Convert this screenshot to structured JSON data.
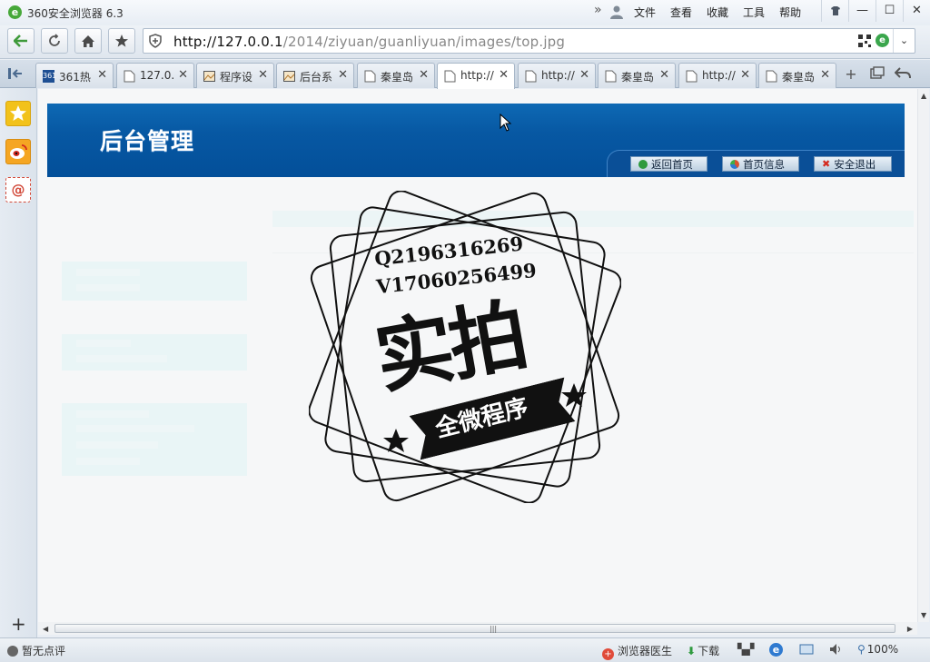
{
  "window": {
    "title": "360安全浏览器 6.3",
    "menu": [
      "文件",
      "查看",
      "收藏",
      "工具",
      "帮助"
    ],
    "controls": [
      "skin",
      "minimize",
      "maximize",
      "close"
    ]
  },
  "toolbar": {
    "url_host": "http://127.0.0.1",
    "url_path": "/2014/ziyuan/guanliyuan/images/top.jpg"
  },
  "tabs": [
    {
      "label": "361热"
    },
    {
      "label": "127.0."
    },
    {
      "label": "程序设"
    },
    {
      "label": "后台系"
    },
    {
      "label": "秦皇岛"
    },
    {
      "label": "http://",
      "active": true
    },
    {
      "label": "http://"
    },
    {
      "label": "秦皇岛"
    },
    {
      "label": "http://"
    },
    {
      "label": "秦皇岛"
    }
  ],
  "page": {
    "banner_title": "后台管理",
    "nav_buttons": [
      {
        "label": "返回首页",
        "icon": "refresh-icon",
        "color": "#2e9a3e"
      },
      {
        "label": "首页信息",
        "icon": "pie-chart-icon",
        "color": "#d8542e"
      },
      {
        "label": "安全退出",
        "icon": "close-icon",
        "color": "#d42b20"
      }
    ]
  },
  "watermark": {
    "qq": "Q2196316269",
    "wechat": "V17060256499",
    "headline": "实拍",
    "ribbon": "全微程序"
  },
  "status": {
    "rating": "暂无点评",
    "doctor": "浏览器医生",
    "download": "下载",
    "zoom": "100%"
  },
  "colors": {
    "banner": "#0758a3",
    "accent_green": "#47a83a"
  }
}
